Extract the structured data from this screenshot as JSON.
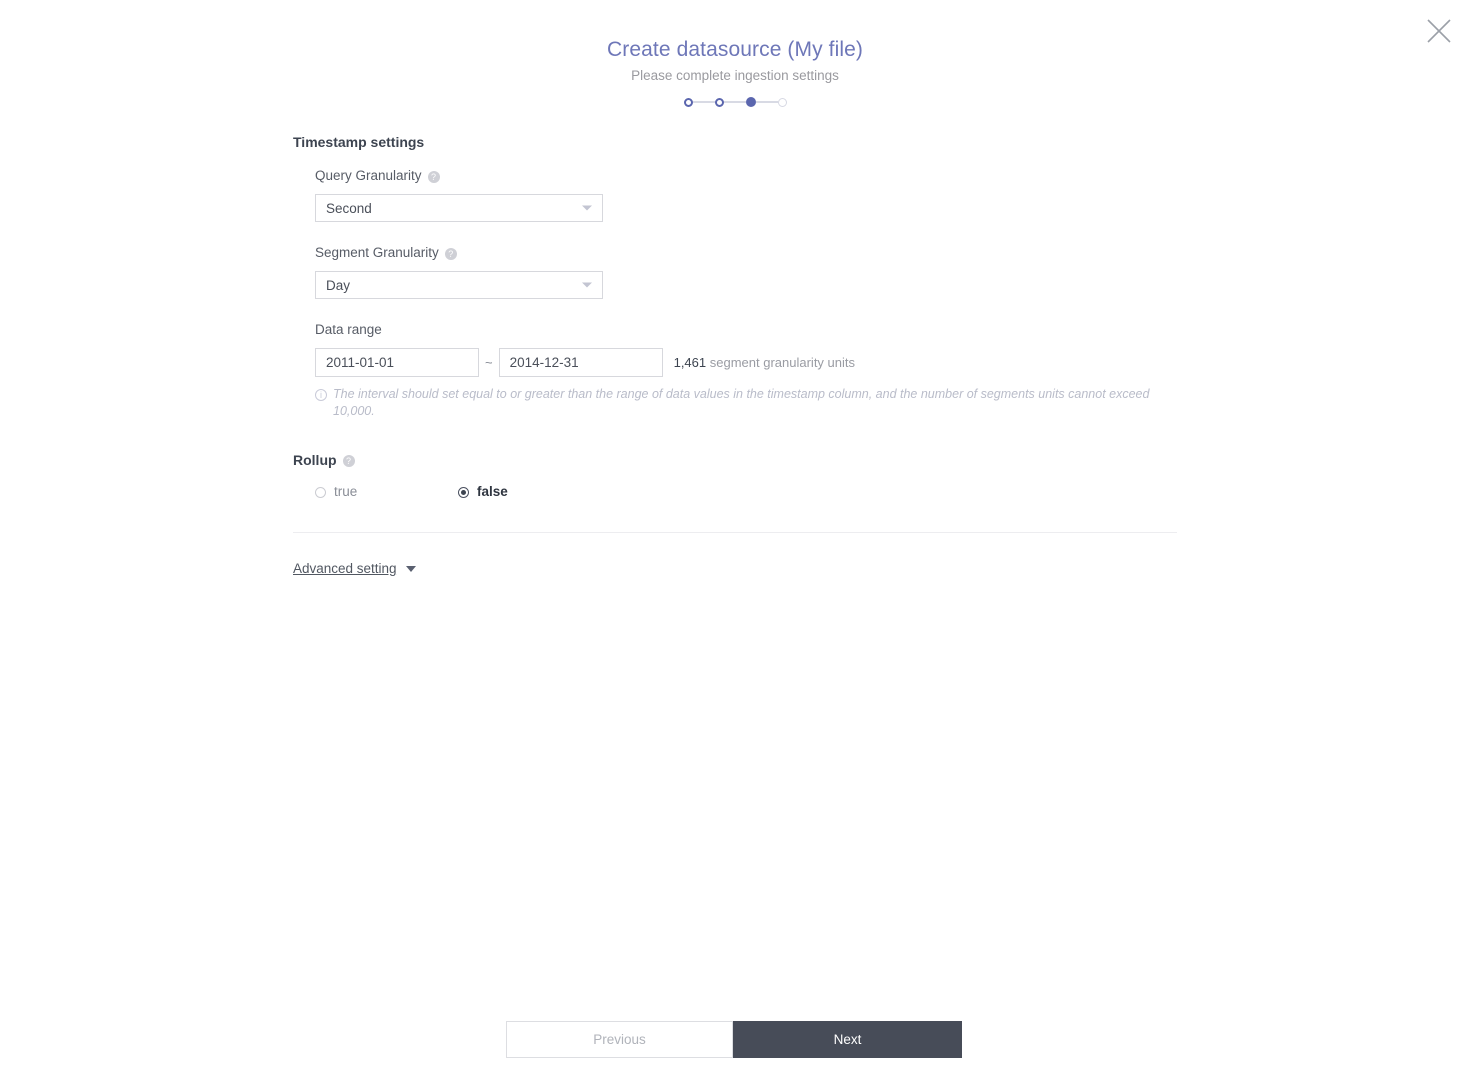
{
  "dialog": {
    "title": "Create datasource (My file)",
    "subtitle": "Please complete ingestion settings",
    "close_icon": "close-icon"
  },
  "stepper": {
    "steps": [
      {
        "state": "done"
      },
      {
        "state": "done"
      },
      {
        "state": "current"
      },
      {
        "state": "todo"
      }
    ]
  },
  "timestamp_settings": {
    "heading": "Timestamp settings",
    "query_granularity": {
      "label": "Query Granularity",
      "help": "?",
      "value": "Second"
    },
    "segment_granularity": {
      "label": "Segment Granularity",
      "help": "?",
      "value": "Day"
    },
    "data_range": {
      "label": "Data range",
      "start": "2011-01-01",
      "end": "2014-12-31",
      "separator": "~",
      "units_count": "1,461",
      "units_text": "segment granularity units",
      "hint_icon": "i",
      "hint": "The interval should set equal to or greater than the range of data values in the timestamp column, and the number of segments units cannot exceed 10,000."
    }
  },
  "rollup": {
    "heading": "Rollup",
    "help": "?",
    "options": [
      {
        "label": "true",
        "selected": false
      },
      {
        "label": "false",
        "selected": true
      }
    ]
  },
  "advanced": {
    "label": "Advanced setting",
    "caret_icon": "chevron-down-icon"
  },
  "footer": {
    "previous_label": "Previous",
    "next_label": "Next"
  },
  "colors": {
    "title": "#6e77b8",
    "accent_step": "#5b66ae",
    "primary_button": "#474c58",
    "heading": "#3d4450"
  }
}
